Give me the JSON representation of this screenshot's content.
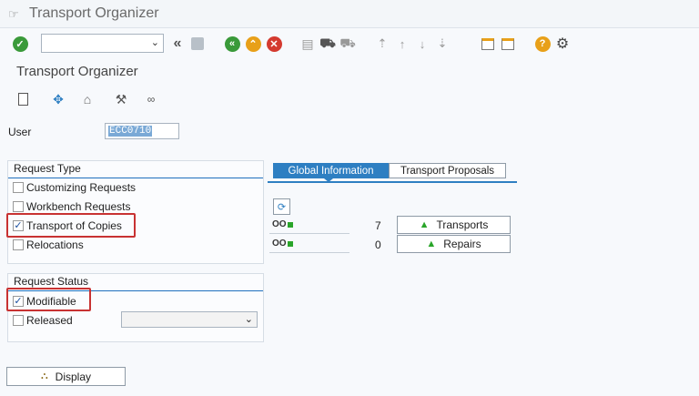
{
  "window": {
    "title": "Transport Organizer",
    "title_icon": "exit-menu-icon"
  },
  "toolbar": {
    "command_field": {
      "value": "",
      "dropdown_icon": "chevron-down-icon"
    },
    "icons": [
      "enter-check-icon",
      "back-double-chevron-icon",
      "save-icon",
      "back-icon",
      "exit-icon",
      "cancel-icon",
      "print-icon",
      "find-icon",
      "find-next-icon",
      "first-page-icon",
      "previous-page-icon",
      "next-page-icon",
      "last-page-icon",
      "create-session-icon",
      "generate-shortcut-icon",
      "help-icon",
      "settings-gear-icon"
    ],
    "colors": {
      "green": "#3a9a3a",
      "orange": "#e8a019",
      "red": "#d43a2f"
    }
  },
  "screen": {
    "title": "Transport Organizer"
  },
  "app_toolbar": {
    "icons": [
      "new-document-icon",
      "move-icon",
      "import-icon",
      "tools-icon",
      "display-glasses-icon"
    ]
  },
  "user": {
    "label": "User",
    "value": "ECC0710"
  },
  "request_type": {
    "title": "Request Type",
    "items": [
      {
        "label": "Customizing Requests",
        "checked": false
      },
      {
        "label": "Workbench Requests",
        "checked": false
      },
      {
        "label": "Transport of Copies",
        "checked": true
      },
      {
        "label": "Relocations",
        "checked": false
      }
    ]
  },
  "request_status": {
    "title": "Request Status",
    "items": [
      {
        "label": "Modifiable",
        "checked": true
      },
      {
        "label": "Released",
        "checked": false
      }
    ],
    "released_select": {
      "value": ""
    }
  },
  "tabs": [
    {
      "label": "Global Information",
      "active": true
    },
    {
      "label": "Transport Proposals",
      "active": false
    }
  ],
  "global_info": {
    "refresh_icon": "refresh-icon",
    "rows": [
      {
        "count": "7",
        "button": "Transports",
        "icon": "transport-truck-icon"
      },
      {
        "count": "0",
        "button": "Repairs",
        "icon": "repair-icon"
      }
    ]
  },
  "display_button": {
    "label": "Display",
    "icon": "hierarchy-icon"
  }
}
